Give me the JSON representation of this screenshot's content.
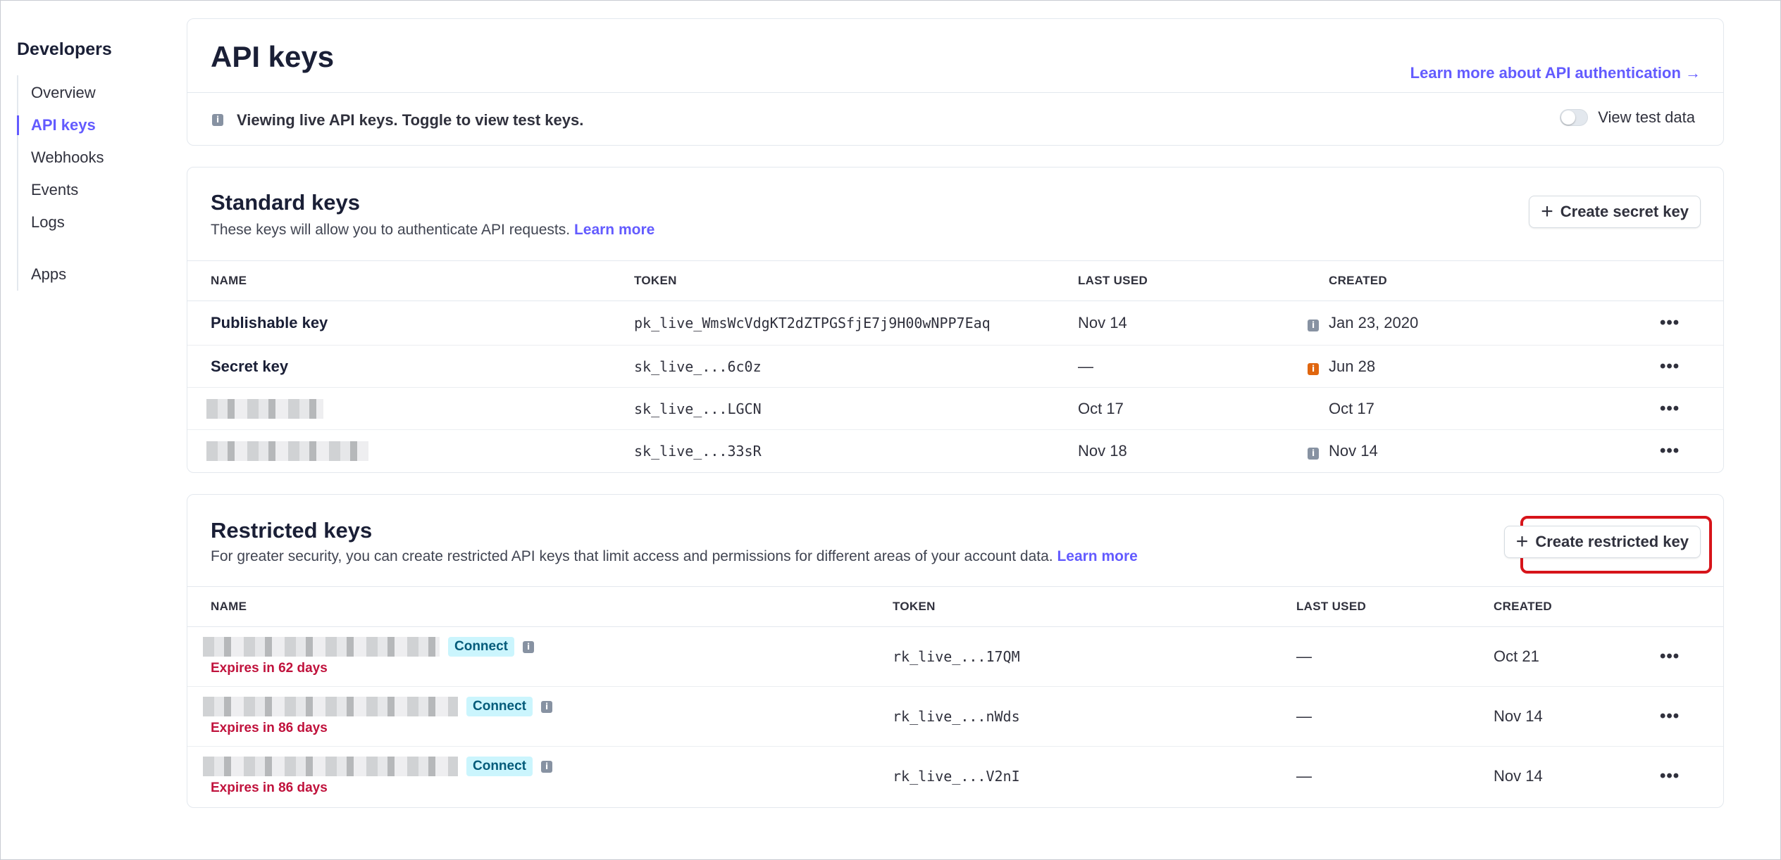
{
  "sidebar": {
    "title": "Developers",
    "items": [
      {
        "label": "Overview"
      },
      {
        "label": "API keys"
      },
      {
        "label": "Webhooks"
      },
      {
        "label": "Events"
      },
      {
        "label": "Logs"
      },
      {
        "label": "Apps"
      }
    ],
    "active_index": 1
  },
  "header": {
    "title": "API keys",
    "auth_link": "Learn more about API authentication →",
    "notice": "Viewing live API keys. Toggle to view test keys.",
    "toggle_label": "View test data",
    "toggle_on": false
  },
  "standard_keys": {
    "title": "Standard keys",
    "description": "These keys will allow you to authenticate API requests.",
    "learn_more": "Learn more",
    "create_button": "Create secret key",
    "columns": [
      "NAME",
      "TOKEN",
      "LAST USED",
      "CREATED"
    ],
    "rows": [
      {
        "name": "Publishable key",
        "token": "pk_live_WmsWcVdgKT2dZTPGSfjE7j9H00wNPP7Eaq",
        "last_used": "Nov 14",
        "info": "gray",
        "created": "Jan 23, 2020"
      },
      {
        "name": "Secret key",
        "token": "sk_live_...6c0z",
        "last_used": "—",
        "info": "orange",
        "created": "Jun 28"
      },
      {
        "name": "",
        "token": "sk_live_...LGCN",
        "last_used": "Oct 17",
        "info": "",
        "created": "Oct 17"
      },
      {
        "name": "",
        "token": "sk_live_...33sR",
        "last_used": "Nov 18",
        "info": "gray",
        "created": "Nov 14"
      }
    ]
  },
  "restricted_keys": {
    "title": "Restricted keys",
    "description": "For greater security, you can create restricted API keys that limit access and permissions for different areas of your account data.",
    "learn_more": "Learn more",
    "create_button": "Create restricted key",
    "columns": [
      "NAME",
      "TOKEN",
      "LAST USED",
      "CREATED"
    ],
    "rows": [
      {
        "badge": "Connect",
        "expires": "Expires in 62 days",
        "token": "rk_live_...17QM",
        "last_used": "—",
        "created": "Oct 21"
      },
      {
        "badge": "Connect",
        "expires": "Expires in 86 days",
        "token": "rk_live_...nWds",
        "last_used": "—",
        "created": "Nov 14"
      },
      {
        "badge": "Connect",
        "expires": "Expires in 86 days",
        "token": "rk_live_...V2nI",
        "last_used": "—",
        "created": "Nov 14"
      }
    ]
  },
  "icons": {
    "info": "info-icon",
    "plus": "plus-icon",
    "more": "more-horizontal-icon",
    "row_more_glyph": "•••"
  },
  "colors": {
    "accent": "#635bff",
    "highlight": "#d7141a",
    "expires": "#c0123c",
    "badge_bg": "#cbf5fd"
  }
}
